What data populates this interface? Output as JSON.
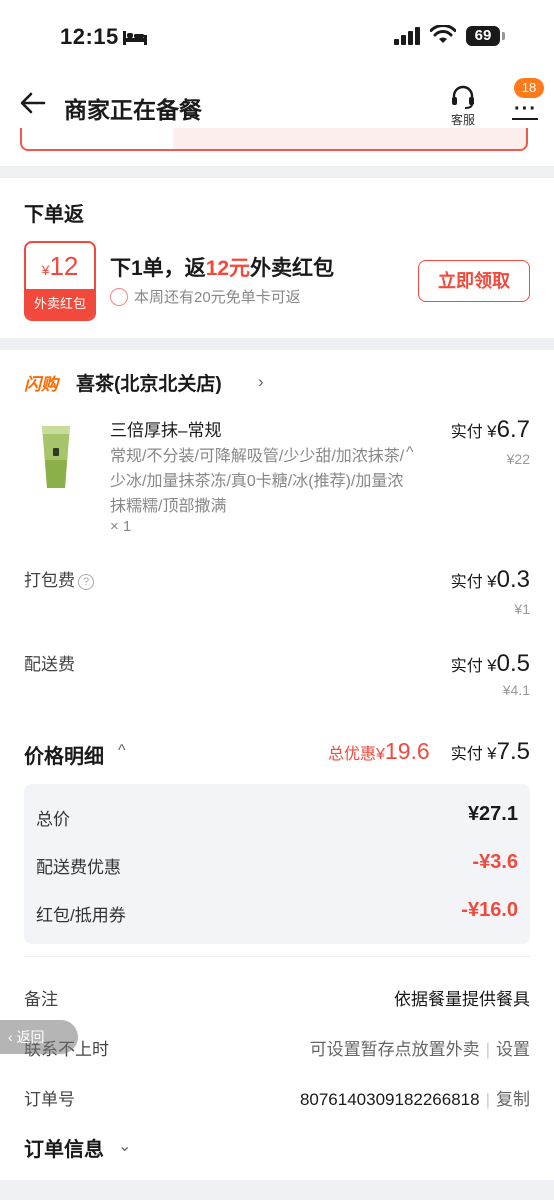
{
  "status_bar": {
    "time": "12:15",
    "battery": "69"
  },
  "nav": {
    "title": "商家正在备餐",
    "service_label": "客服",
    "more_badge": "18"
  },
  "rebate": {
    "title": "下单返",
    "coupon_currency": "¥",
    "coupon_amount": "12",
    "coupon_label": "外卖红包",
    "headline_prefix": "下1单，返",
    "headline_amount": "12元",
    "headline_suffix": "外卖红包",
    "subtext": "本周还有20元免单卡可返",
    "claim_button": "立即领取"
  },
  "shop": {
    "tag": "闪购",
    "name": "喜茶(北京北关店)"
  },
  "item": {
    "name": "三倍厚抹–常规",
    "spec": "常规/不分装/可降解吸管/少少甜/加浓抹茶/少冰/加量抹茶冻/真0卡糖/冰(推荐)/加量浓抹糯糯/顶部撒满",
    "qty": "× 1",
    "paid_label": "实付",
    "paid_currency": "¥",
    "paid_amount": "6.7",
    "original": "¥22"
  },
  "fees": [
    {
      "label": "打包费",
      "paid_label": "实付",
      "currency": "¥",
      "amount": "0.3",
      "original": "¥1"
    },
    {
      "label": "配送费",
      "paid_label": "实付",
      "currency": "¥",
      "amount": "0.5",
      "original": "¥4.1"
    }
  ],
  "price_detail": {
    "title": "价格明细",
    "discount_label": "总优惠",
    "discount_currency": "¥",
    "discount_amount": "19.6",
    "paid_label": "实付",
    "paid_currency": "¥",
    "paid_amount": "7.5",
    "rows": [
      {
        "label": "总价",
        "value": "¥27.1"
      },
      {
        "label": "配送费优惠",
        "value": "-¥3.6"
      },
      {
        "label": "红包/抵用券",
        "value": "-¥16.0"
      }
    ]
  },
  "info": {
    "remark_label": "备注",
    "remark_value": "依据餐量提供餐具",
    "contact_label": "联系不上时",
    "contact_value": "可设置暂存点放置外卖",
    "contact_action": "设置",
    "order_no_label": "订单号",
    "order_no_value": "8076140309182266818",
    "order_no_action": "复制",
    "order_info_title": "订单信息"
  },
  "float_back": "返回",
  "colors": {
    "accent_red": "#f14a3c",
    "flash_orange": "#ff6a00",
    "badge_orange": "#ff7a1a"
  }
}
